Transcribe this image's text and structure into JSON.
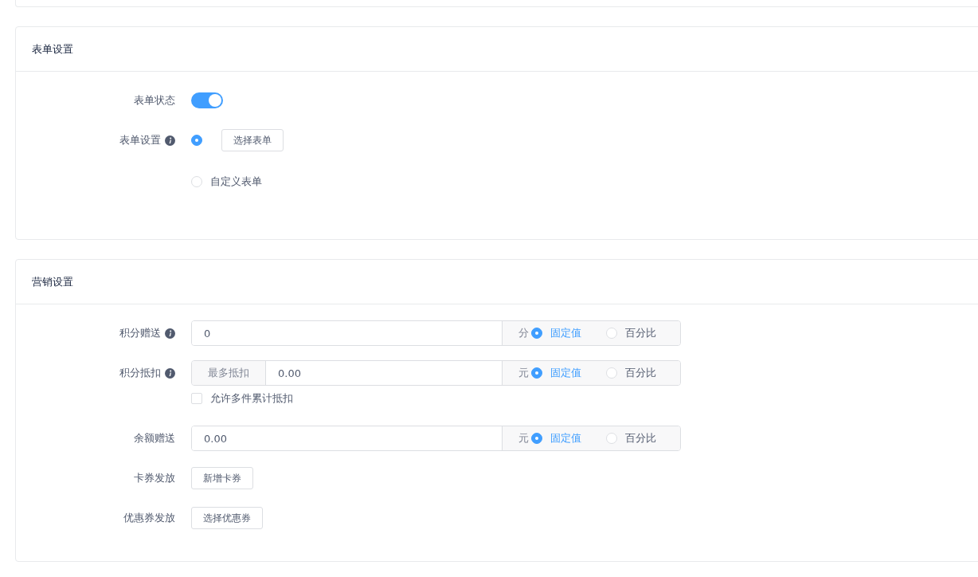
{
  "sections": [
    {
      "title": "表单设置",
      "fields": [
        {
          "kind": "switch",
          "label": "表单状态",
          "info": false,
          "on": true
        },
        {
          "kind": "radios",
          "label": "表单设置",
          "info": true,
          "options": [
            {
              "selected": true,
              "button": "选择表单"
            },
            {
              "selected": false,
              "text": "自定义表单"
            }
          ]
        }
      ]
    },
    {
      "title": "营销设置",
      "fields": [
        {
          "kind": "input",
          "label": "积分赠送",
          "info": true,
          "value": "0",
          "unit": "分",
          "options": [
            {
              "label": "固定值",
              "selected": true
            },
            {
              "label": "百分比",
              "selected": false
            }
          ]
        },
        {
          "kind": "input",
          "label": "积分抵扣",
          "info": true,
          "prefix": "最多抵扣",
          "value": "0.00",
          "unit": "元",
          "options": [
            {
              "label": "固定值",
              "selected": true
            },
            {
              "label": "百分比",
              "selected": false
            }
          ],
          "checkbox": {
            "label": "允许多件累计抵扣",
            "checked": false
          }
        },
        {
          "kind": "input",
          "label": "余额赠送",
          "info": false,
          "value": "0.00",
          "unit": "元",
          "options": [
            {
              "label": "固定值",
              "selected": true
            },
            {
              "label": "百分比",
              "selected": false
            }
          ]
        },
        {
          "kind": "button",
          "label": "卡券发放",
          "info": false,
          "button": "新增卡券"
        },
        {
          "kind": "button",
          "label": "优惠券发放",
          "info": false,
          "button": "选择优惠券"
        }
      ]
    }
  ]
}
